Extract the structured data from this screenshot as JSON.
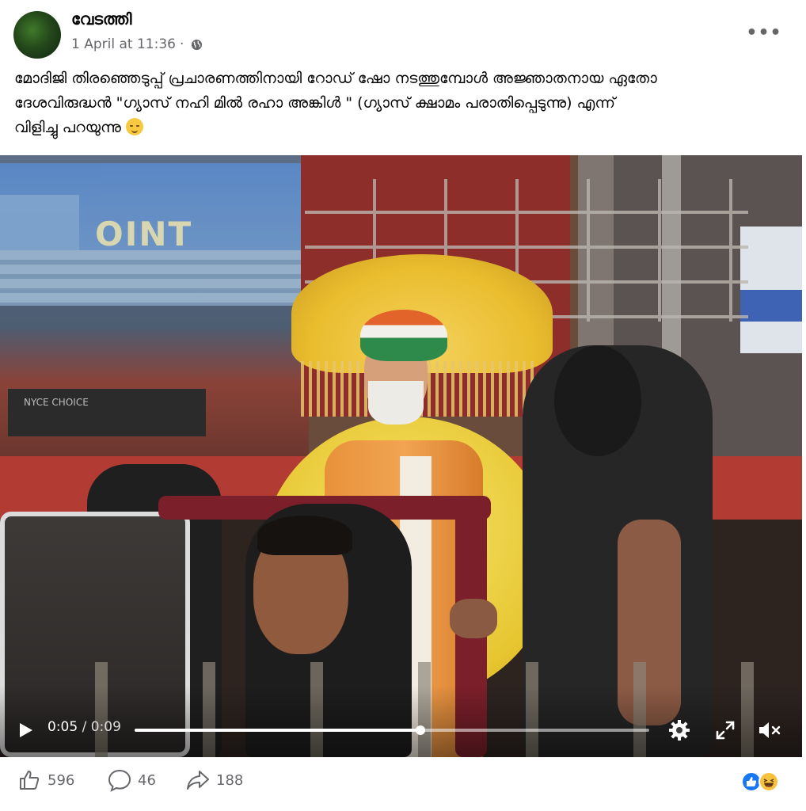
{
  "post": {
    "author": "വേടത്തി",
    "timestamp": "1 April at 11:36",
    "separator": "·",
    "privacy_icon": "globe-icon",
    "more_label": "•••",
    "caption_line1": "മോദിജി തിരഞ്ഞെടുപ്പ് പ്രചാരണത്തിനായി റോഡ് ഷോ നടത്തുമ്പോൾ  അജ്ഞാതനായ ഏതോ",
    "caption_line2": "ദേശവിരുദ്ധൻ \"ഗ്യാസ് നഹി മിൽ രഹാ അങ്കിൾ \" (ഗ്യാസ് ക്ഷാമം പരാതിപ്പെടുന്നു) എന്ന്",
    "caption_line3": "വിളിച്ചു പറയുന്നു"
  },
  "video": {
    "current_time": "0:05",
    "time_separator": " / ",
    "duration": "0:09",
    "progress": 0.555,
    "sign_text": "OINT",
    "shop_sign_text": "NYCE CHOICE"
  },
  "footer": {
    "likes": "596",
    "comments": "46",
    "shares": "188"
  },
  "colors": {
    "author_text": "#050505",
    "meta_text": "#65676b",
    "like_blue": "#1877f2",
    "haha_yellow": "#f7c23f"
  }
}
